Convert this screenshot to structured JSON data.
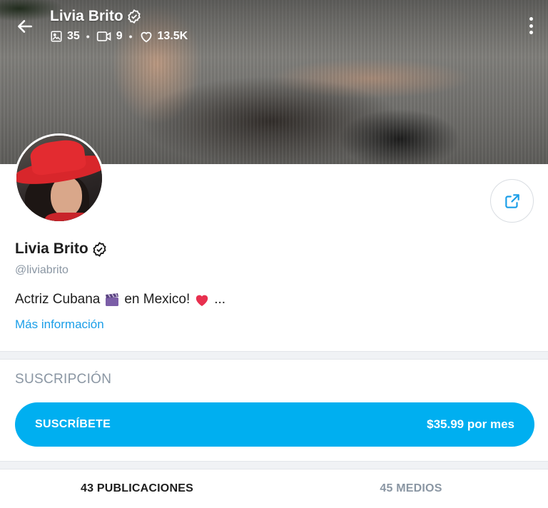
{
  "header": {
    "name": "Livia Brito",
    "stats": {
      "photos": "35",
      "videos": "9",
      "likes": "13.5K"
    }
  },
  "profile": {
    "name": "Livia Brito",
    "handle": "@liviabrito",
    "bio_before": "Actriz Cubana",
    "bio_after": "en Mexico!",
    "bio_ellipsis": "...",
    "more_info": "Más información"
  },
  "subscription": {
    "title": "SUSCRIPCIÓN",
    "button_label": "SUSCRÍBETE",
    "price": "$35.99 por mes"
  },
  "tabs": [
    {
      "label": "43 PUBLICACIONES",
      "active": true
    },
    {
      "label": "45 MEDIOS",
      "active": false
    }
  ],
  "colors": {
    "accent": "#00aff0",
    "link": "#1a9ee8",
    "muted": "#8a96a3",
    "heart": "#e8304f"
  },
  "icons": [
    "back-arrow-icon",
    "verified-icon",
    "image-icon",
    "video-icon",
    "heart-icon",
    "more-vertical-icon",
    "share-icon",
    "clapperboard-emoji",
    "heart-emoji"
  ]
}
